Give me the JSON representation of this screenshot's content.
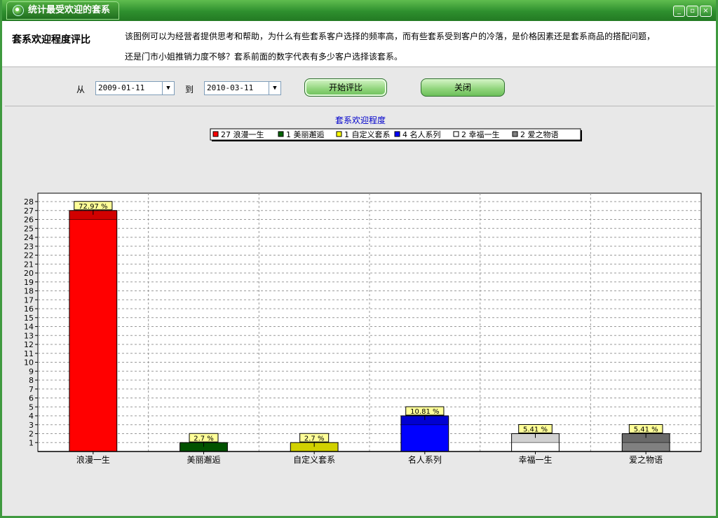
{
  "window": {
    "title": "统计最受欢迎的套系",
    "minimize": "_",
    "restore": "▫",
    "close": "×"
  },
  "header": {
    "title": "套系欢迎程度评比",
    "desc_line1": "该图例可以为经营者提供思考和帮助，为什么有些套系客户选择的频率高，而有些套系受到客户的冷落，是价格因素还是套系商品的搭配问题，",
    "desc_line2": "还是门市小姐推销力度不够？套系前面的数字代表有多少客户选择该套系。"
  },
  "controls": {
    "from_label": "从",
    "from_date": "2009-01-11",
    "to_label": "到",
    "to_date": "2010-03-11",
    "start_button": "开始评比",
    "close_button": "关闭"
  },
  "chart_data": {
    "type": "bar",
    "title": "套系欢迎程度",
    "categories": [
      "浪漫一生",
      "美丽邂逅",
      "自定义套系",
      "名人系列",
      "幸福一生",
      "爱之物语"
    ],
    "values": [
      27,
      1,
      1,
      4,
      2,
      2
    ],
    "percent_labels": [
      "72.97 %",
      "2.7 %",
      "2.7 %",
      "10.81 %",
      "5.41 %",
      "5.41 %"
    ],
    "legend": [
      "27 浪漫一生",
      "1 美丽邂逅",
      "1 自定义套系",
      "4 名人系列",
      "2 幸福一生",
      "2 爱之物语"
    ],
    "colors": [
      "#ff0000",
      "#006400",
      "#ffff00",
      "#0000ff",
      "#ffffff",
      "#808080"
    ],
    "ylim": [
      0,
      28
    ],
    "yticks": [
      1,
      2,
      3,
      4,
      5,
      6,
      7,
      8,
      9,
      10,
      11,
      12,
      13,
      14,
      15,
      16,
      17,
      18,
      19,
      20,
      21,
      22,
      23,
      24,
      25,
      26,
      27,
      28
    ],
    "grid": true,
    "legend_position": "top-center"
  }
}
